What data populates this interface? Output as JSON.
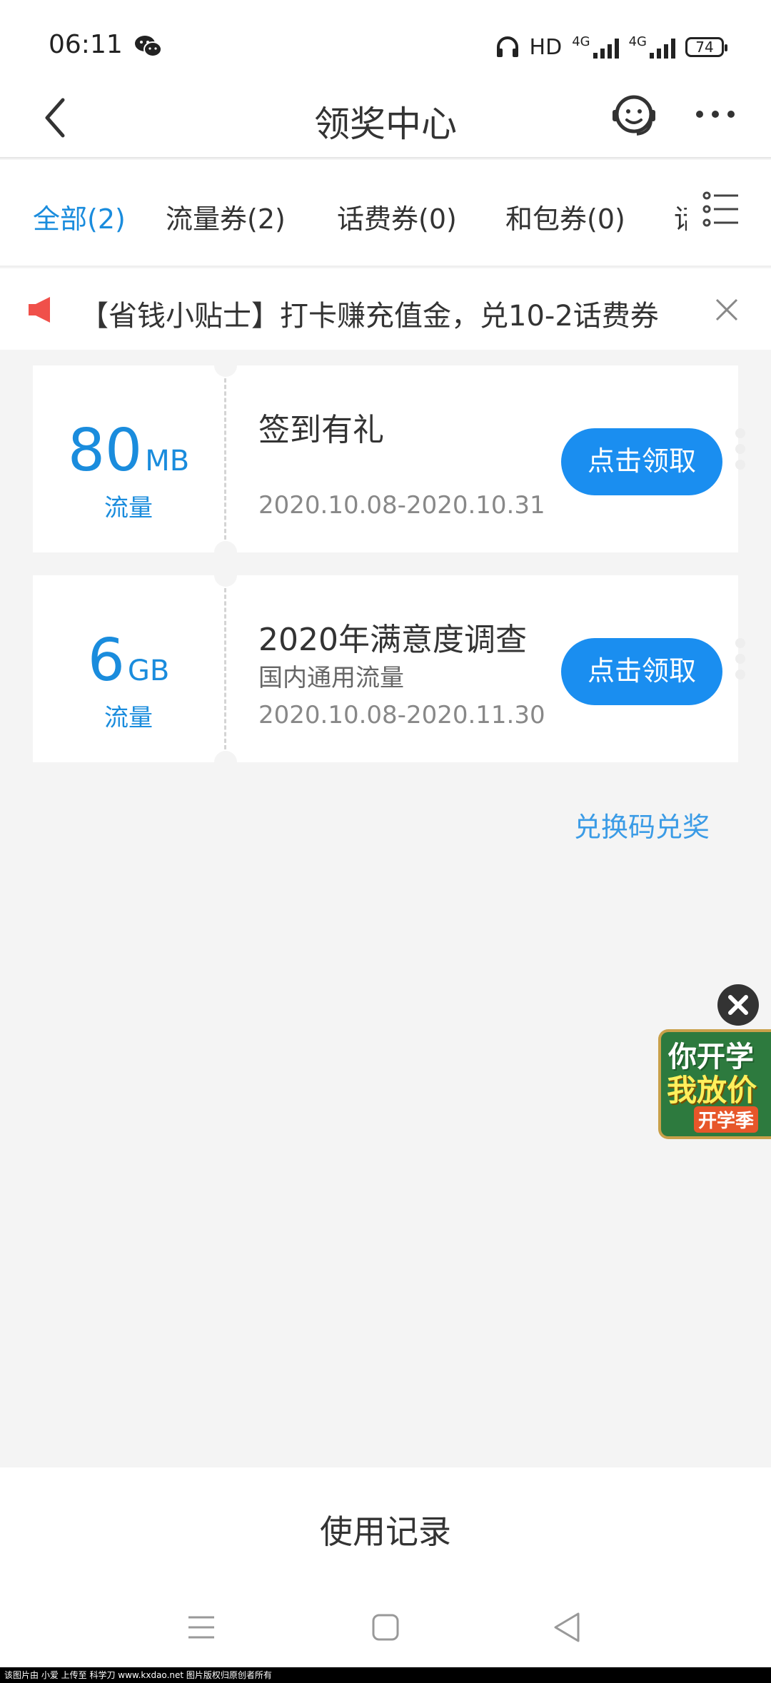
{
  "status_bar": {
    "time": "06:11",
    "hd_label": "HD",
    "net1": "4G",
    "net2": "4G",
    "battery": "74"
  },
  "header": {
    "title": "领奖中心"
  },
  "tabs": [
    {
      "label": "全部(2)",
      "active": true
    },
    {
      "label": "流量券(2)",
      "active": false
    },
    {
      "label": "话费券(0)",
      "active": false
    },
    {
      "label": "和包券(0)",
      "active": false
    },
    {
      "label": "话",
      "active": false
    }
  ],
  "notice": {
    "text": "【省钱小贴士】打卡赚充值金，兑10-2话费券"
  },
  "coupons": [
    {
      "amount": "80",
      "unit": "MB",
      "type": "流量",
      "title": "签到有礼",
      "subtitle": "",
      "date": "2020.10.08-2020.10.31",
      "button": "点击领取"
    },
    {
      "amount": "6",
      "unit": "GB",
      "type": "流量",
      "title": "2020年满意度调查",
      "subtitle": "国内通用流量",
      "date": "2020.10.08-2020.11.30",
      "button": "点击领取"
    }
  ],
  "redeem_link": "兑换码兑奖",
  "ad": {
    "line1": "你开学",
    "line2": "我放价",
    "line3": "开学季"
  },
  "footer": {
    "usage_record": "使用记录"
  },
  "watermark": "该图片由 小爱 上传至 科学刀 www.kxdao.net 图片版权归原创者所有",
  "colors": {
    "accent": "#1a8cdd",
    "button": "#1a8ef0",
    "notice_icon": "#f0504a",
    "background": "#f4f4f4"
  }
}
